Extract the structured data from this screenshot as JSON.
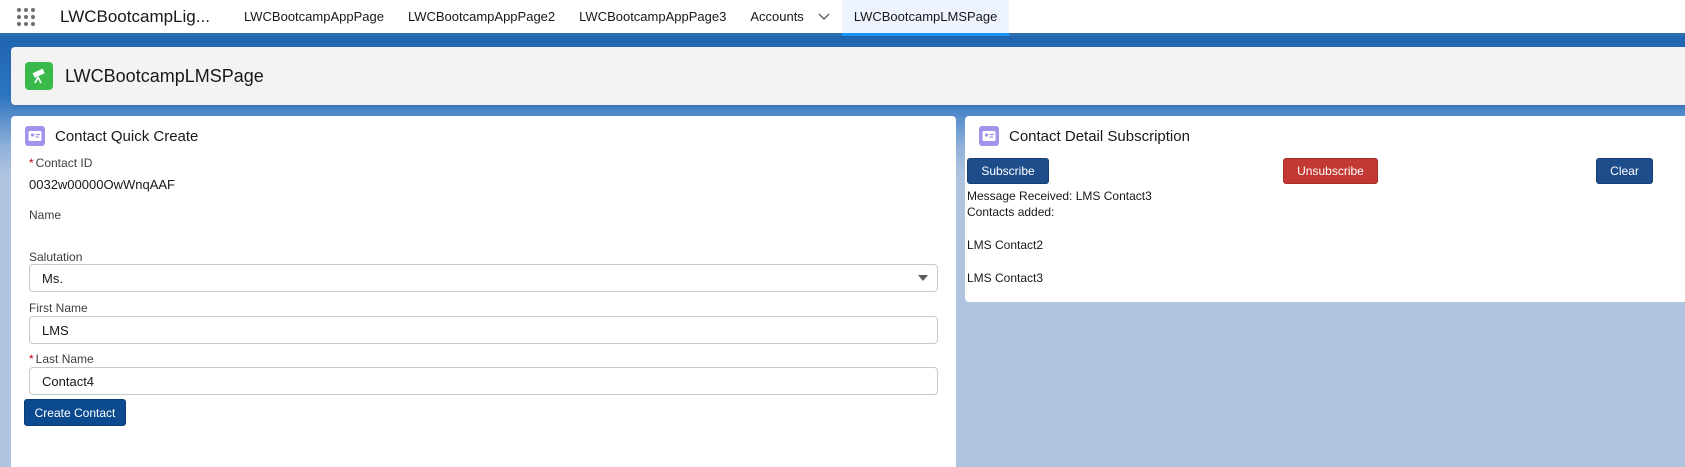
{
  "nav": {
    "app_name": "LWCBootcampLig...",
    "tabs": [
      {
        "label": "LWCBootcampAppPage"
      },
      {
        "label": "LWCBootcampAppPage2"
      },
      {
        "label": "LWCBootcampAppPage3"
      },
      {
        "label": "Accounts"
      },
      {
        "label": "LWCBootcampLMSPage"
      }
    ],
    "active_tab": "LWCBootcampLMSPage"
  },
  "page": {
    "title": "LWCBootcampLMSPage",
    "icon": "telescope-icon"
  },
  "quick_create": {
    "title": "Contact Quick Create",
    "icon": "contact-card-icon",
    "contact_id_label": "Contact ID",
    "contact_id_value": "0032w00000OwWnqAAF",
    "name_label": "Name",
    "salutation_label": "Salutation",
    "salutation_value": "Ms.",
    "first_name_label": "First Name",
    "first_name_value": "LMS",
    "last_name_label": "Last Name",
    "last_name_value": "Contact4",
    "required_mark": "*",
    "create_button": "Create Contact"
  },
  "subscription": {
    "title": "Contact Detail Subscription",
    "icon": "contact-card-icon",
    "subscribe_button": "Subscribe",
    "unsubscribe_button": "Unsubscribe",
    "clear_button": "Clear",
    "message_received": "Message Received: LMS Contact3",
    "contacts_added_label": "Contacts added:",
    "contacts": [
      "LMS Contact2",
      "LMS Contact3"
    ]
  },
  "colors": {
    "brand_blue": "#0b4a8f",
    "danger_red": "#c23934",
    "page_icon_green": "#3bba4c",
    "card_icon_purple": "#a094ed"
  }
}
